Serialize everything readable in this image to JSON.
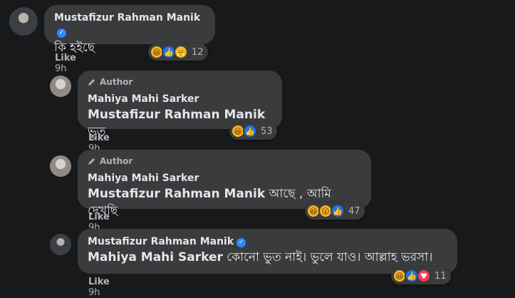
{
  "comments": [
    {
      "author": "Mustafizur Rahman Manik",
      "verified": true,
      "text": "কি হইছে",
      "like_label": "Like",
      "time": "9h",
      "reaction_count": "12",
      "reactions": [
        "haha-icon",
        "like-icon",
        "care-icon"
      ]
    },
    {
      "author_tag": "Author",
      "author": "Mahiya Mahi Sarker",
      "mention": "Mustafizur Rahman Manik",
      "text": "ভুত",
      "like_label": "Like",
      "time": "9h",
      "reaction_count": "53",
      "reactions": [
        "haha-icon",
        "like-icon"
      ]
    },
    {
      "author_tag": "Author",
      "author": "Mahiya Mahi Sarker",
      "mention": "Mustafizur Rahman Manik",
      "text": "আছে , আমি দেখছি",
      "like_label": "Like",
      "time": "9h",
      "reaction_count": "47",
      "reactions": [
        "haha-icon",
        "wow-icon",
        "like-icon"
      ]
    },
    {
      "author": "Mustafizur Rahman Manik",
      "verified": true,
      "mention": "Mahiya Mahi Sarker",
      "text": "কোনো ভুত নাই। ভুলে যাও। আল্লাহ ভরসা।",
      "like_label": "Like",
      "time": "9h",
      "reaction_count": "11",
      "reactions": [
        "haha-icon",
        "like-icon",
        "love-icon"
      ]
    }
  ],
  "colors": {
    "background": "#18191a",
    "bubble": "#3a3b3c",
    "verified": "#2d88ff",
    "like": "#1877f2",
    "haha": "#f7b125",
    "love": "#f33e58"
  }
}
